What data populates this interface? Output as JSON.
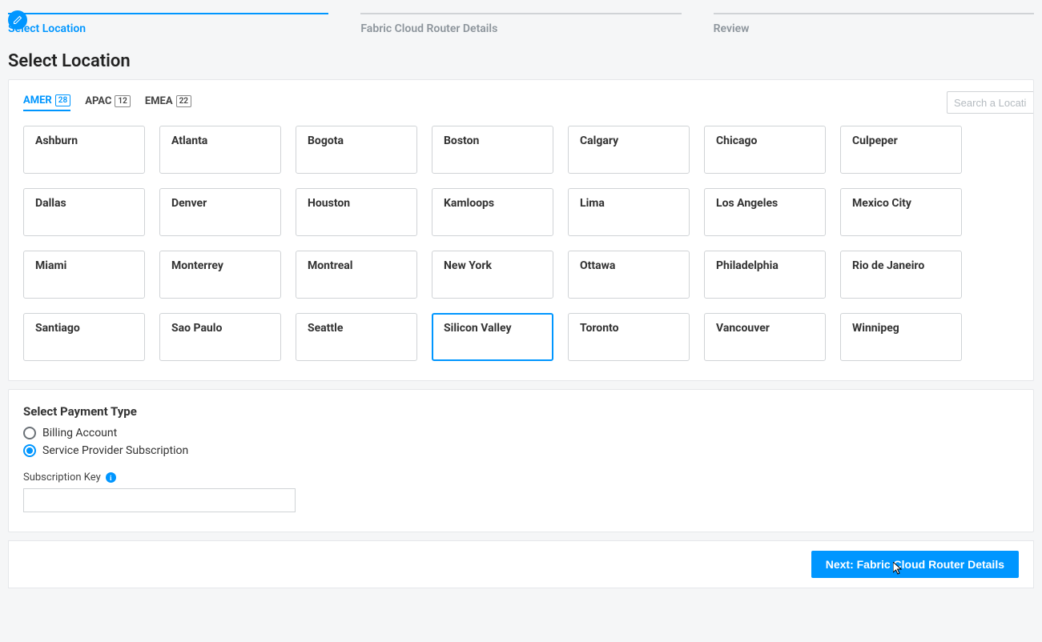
{
  "stepper": {
    "steps": [
      {
        "label": "Select Location",
        "active": true,
        "icon": "edit"
      },
      {
        "label": "Fabric Cloud Router Details",
        "active": false
      },
      {
        "label": "Review",
        "active": false
      }
    ]
  },
  "page_title": "Select Location",
  "location_tabs": [
    {
      "name": "AMER",
      "count": "28",
      "active": true
    },
    {
      "name": "APAC",
      "count": "12",
      "active": false
    },
    {
      "name": "EMEA",
      "count": "22",
      "active": false
    }
  ],
  "search": {
    "placeholder": "Search a Location"
  },
  "locations": [
    "Ashburn",
    "Atlanta",
    "Bogota",
    "Boston",
    "Calgary",
    "Chicago",
    "Culpeper",
    "Dallas",
    "Denver",
    "Houston",
    "Kamloops",
    "Lima",
    "Los Angeles",
    "Mexico City",
    "Miami",
    "Monterrey",
    "Montreal",
    "New York",
    "Ottawa",
    "Philadelphia",
    "Rio de Janeiro",
    "Santiago",
    "Sao Paulo",
    "Seattle",
    "Silicon Valley",
    "Toronto",
    "Vancouver",
    "Winnipeg"
  ],
  "selected_location": "Silicon Valley",
  "payment": {
    "heading": "Select Payment Type",
    "options": [
      {
        "label": "Billing Account",
        "checked": false
      },
      {
        "label": "Service Provider Subscription",
        "checked": true
      }
    ],
    "subscription_label": "Subscription Key",
    "subscription_value": ""
  },
  "next_button": "Next: Fabric Cloud Router Details"
}
